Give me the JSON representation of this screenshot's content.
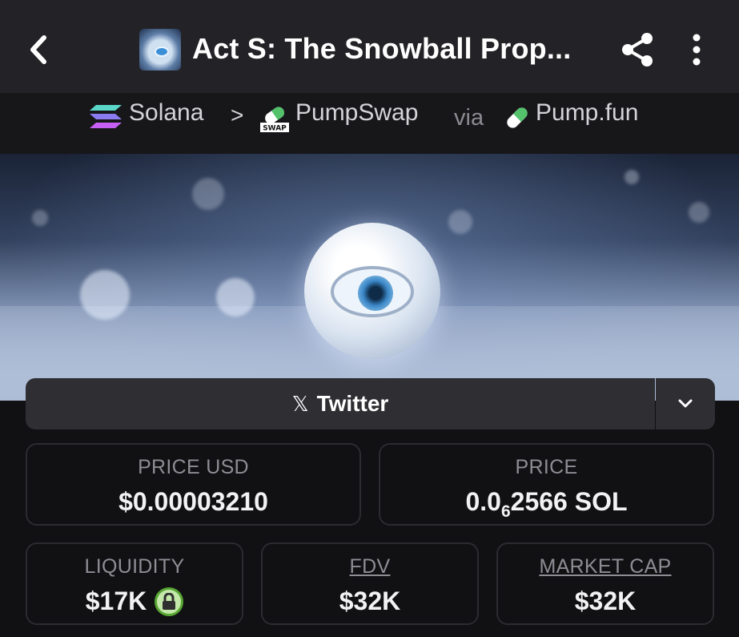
{
  "header": {
    "title": "Act S: The Snowball Prop...",
    "back_icon": "chevron-left-icon",
    "share_icon": "share-icon",
    "more_icon": "more-vertical-icon"
  },
  "breadcrumb": {
    "chain": "Solana",
    "separator": ">",
    "dex": "PumpSwap",
    "dex_badge": "SWAP",
    "via": "via",
    "launchpad": "Pump.fun"
  },
  "social": {
    "twitter_label": "Twitter",
    "x_glyph": "𝕏"
  },
  "stats": {
    "price_usd": {
      "label": "PRICE USD",
      "value": "$0.00003210"
    },
    "price": {
      "label": "PRICE",
      "value_prefix": "0.0",
      "value_subscript": "6",
      "value_suffix": "2566 SOL"
    },
    "liquidity": {
      "label": "LIQUIDITY",
      "value": "$17K"
    },
    "fdv": {
      "label": "FDV",
      "value": "$32K"
    },
    "market_cap": {
      "label": "MARKET CAP",
      "value": "$32K"
    }
  },
  "colors": {
    "header_bg": "#232327",
    "page_bg": "#111114",
    "lock_green": "#57a532"
  }
}
